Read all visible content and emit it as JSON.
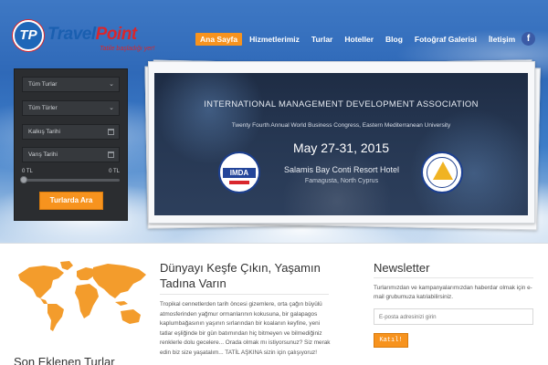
{
  "brand": {
    "badge_letters": "TP",
    "name_part1": "Travel",
    "name_part2": "Point",
    "tagline": "Tatile başladığı yer!",
    "colors": {
      "blue": "#1a5fb0",
      "red": "#d9262c",
      "accent": "#f7931e"
    }
  },
  "nav": {
    "items": [
      {
        "label": "Ana Sayfa",
        "active": true
      },
      {
        "label": "Hizmetlerimiz"
      },
      {
        "label": "Turlar"
      },
      {
        "label": "Hoteller"
      },
      {
        "label": "Blog"
      },
      {
        "label": "Fotoğraf Galerisi"
      },
      {
        "label": "İletişim"
      }
    ],
    "social": {
      "icon": "facebook-icon",
      "glyph": "f"
    }
  },
  "search": {
    "select1": "Tüm Turlar",
    "select2": "Tüm Türler",
    "departure_placeholder": "Kalkış Tarihi",
    "return_placeholder": "Varış Tarihi",
    "price_min": "0 TL",
    "price_max": "0 TL",
    "button": "Turlarda Ara"
  },
  "banner": {
    "org": "INTERNATIONAL MANAGEMENT DEVELOPMENT ASSOCIATION",
    "subtitle": "Twenty Fourth Annual World Business Congress, Eastern Mediterranean University",
    "date": "May 27-31, 2015",
    "venue": "Salamis Bay Conti Resort Hotel",
    "city": "Famagusta, North Cyprus",
    "seal_left_text": "IMDA"
  },
  "discover": {
    "title": "Dünyayı Keşfe Çıkın, Yaşamın Tadına Varın",
    "text": "Tropikal cennetlerden tarih öncesi gizemlere, orta çağın büyülü atmosferinden yağmur ormanlarının kokusuna, bir galapagos kaplumbağasının yaşının sırlarından bir koalanın keyfine, yeni tatlar eşliğinde bir gün batımından hiç bitmeyen ve bilmediğiniz renklerle dolu gecelere... Orada olmak mı istiyorsunuz? Siz merak edin biz size yaşatalım... TATİL AŞKINA sizin için çalışıyoruz!"
  },
  "newsletter": {
    "title": "Newsletter",
    "text": "Turlarımızdan ve kampanyalarımızdan haberdar olmak için e-mail grubumuza katılabilirsiniz.",
    "placeholder": "E-posta adresinizi girin",
    "button": "Katıl!"
  },
  "latest": {
    "title": "Son Eklenen Turlar"
  }
}
